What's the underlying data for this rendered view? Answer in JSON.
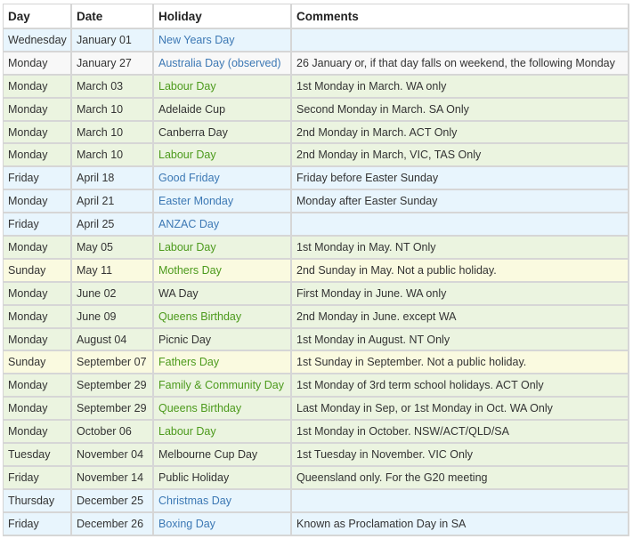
{
  "table": {
    "headers": {
      "day": "Day",
      "date": "Date",
      "holiday": "Holiday",
      "comments": "Comments"
    },
    "row_colors": {
      "blue": "#e8f5fd",
      "white": "#f8f8f8",
      "green": "#ebf4e0",
      "yellow": "#fafae0"
    },
    "holiday_text_colors": {
      "blue": "#3c78b4",
      "green": "#4c9a1c",
      "plain": "#333333"
    },
    "rows": [
      {
        "day": "Wednesday",
        "date": "January 01",
        "holiday": "New Years Day",
        "comments": "",
        "row_color": "blue",
        "holiday_color": "blue"
      },
      {
        "day": "Monday",
        "date": "January 27",
        "holiday": "Australia Day (observed)",
        "comments": "26 January or, if that day falls on weekend, the following Monday",
        "row_color": "white",
        "holiday_color": "blue"
      },
      {
        "day": "Monday",
        "date": "March 03",
        "holiday": "Labour Day",
        "comments": "1st Monday in March. WA only",
        "row_color": "green",
        "holiday_color": "green"
      },
      {
        "day": "Monday",
        "date": "March 10",
        "holiday": "Adelaide Cup",
        "comments": "Second Monday in March. SA Only",
        "row_color": "green",
        "holiday_color": "plain"
      },
      {
        "day": "Monday",
        "date": "March 10",
        "holiday": "Canberra Day",
        "comments": "2nd Monday in March. ACT Only",
        "row_color": "green",
        "holiday_color": "plain"
      },
      {
        "day": "Monday",
        "date": "March 10",
        "holiday": "Labour Day",
        "comments": "2nd Monday in March, VIC, TAS Only",
        "row_color": "green",
        "holiday_color": "green"
      },
      {
        "day": "Friday",
        "date": "April 18",
        "holiday": "Good Friday",
        "comments": "Friday before Easter Sunday",
        "row_color": "blue",
        "holiday_color": "blue"
      },
      {
        "day": "Monday",
        "date": "April 21",
        "holiday": "Easter Monday",
        "comments": "Monday after Easter Sunday",
        "row_color": "blue",
        "holiday_color": "blue"
      },
      {
        "day": "Friday",
        "date": "April 25",
        "holiday": "ANZAC Day",
        "comments": "",
        "row_color": "blue",
        "holiday_color": "blue"
      },
      {
        "day": "Monday",
        "date": "May 05",
        "holiday": "Labour Day",
        "comments": "1st Monday in May. NT Only",
        "row_color": "green",
        "holiday_color": "green"
      },
      {
        "day": "Sunday",
        "date": "May 11",
        "holiday": "Mothers Day",
        "comments": "2nd Sunday in May. Not a public holiday.",
        "row_color": "yellow",
        "holiday_color": "green"
      },
      {
        "day": "Monday",
        "date": "June 02",
        "holiday": "WA Day",
        "comments": "First Monday in June. WA only",
        "row_color": "green",
        "holiday_color": "plain"
      },
      {
        "day": "Monday",
        "date": "June 09",
        "holiday": "Queens Birthday",
        "comments": "2nd Monday in June. except WA",
        "row_color": "green",
        "holiday_color": "green"
      },
      {
        "day": "Monday",
        "date": "August 04",
        "holiday": "Picnic Day",
        "comments": "1st Monday in August. NT Only",
        "row_color": "green",
        "holiday_color": "plain"
      },
      {
        "day": "Sunday",
        "date": "September 07",
        "holiday": "Fathers Day",
        "comments": "1st Sunday in September. Not a public holiday.",
        "row_color": "yellow",
        "holiday_color": "green"
      },
      {
        "day": "Monday",
        "date": "September 29",
        "holiday": "Family & Community Day",
        "comments": "1st Monday of 3rd term school holidays. ACT Only",
        "row_color": "green",
        "holiday_color": "green"
      },
      {
        "day": "Monday",
        "date": "September 29",
        "holiday": "Queens Birthday",
        "comments": "Last Monday in Sep, or 1st Monday in Oct. WA Only",
        "row_color": "green",
        "holiday_color": "green"
      },
      {
        "day": "Monday",
        "date": "October 06",
        "holiday": "Labour Day",
        "comments": "1st Monday in October. NSW/ACT/QLD/SA",
        "row_color": "green",
        "holiday_color": "green"
      },
      {
        "day": "Tuesday",
        "date": "November 04",
        "holiday": "Melbourne Cup Day",
        "comments": "1st Tuesday in November. VIC Only",
        "row_color": "green",
        "holiday_color": "plain"
      },
      {
        "day": "Friday",
        "date": "November 14",
        "holiday": "Public Holiday",
        "comments": "Queensland only. For the G20 meeting",
        "row_color": "green",
        "holiday_color": "plain"
      },
      {
        "day": "Thursday",
        "date": "December 25",
        "holiday": "Christmas Day",
        "comments": "",
        "row_color": "blue",
        "holiday_color": "blue"
      },
      {
        "day": "Friday",
        "date": "December 26",
        "holiday": "Boxing Day",
        "comments": "Known as Proclamation Day in SA",
        "row_color": "blue",
        "holiday_color": "blue"
      }
    ]
  }
}
